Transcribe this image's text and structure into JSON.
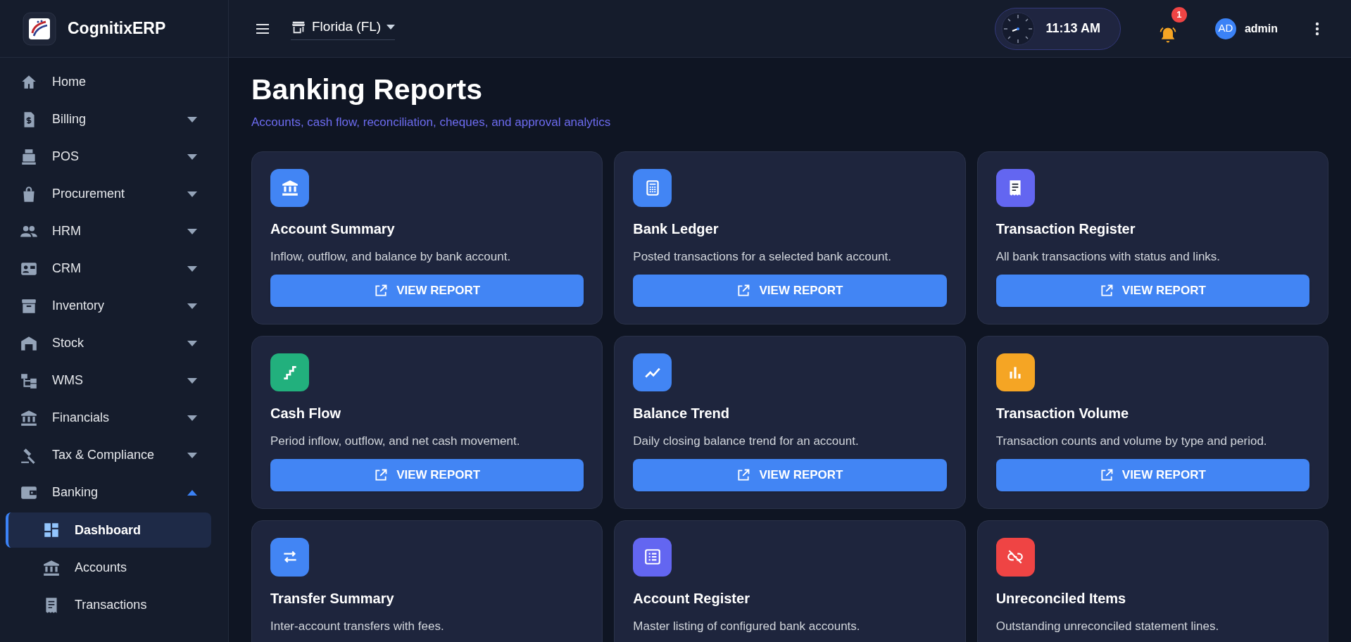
{
  "brand": {
    "name": "CognitixERP"
  },
  "sidebar": {
    "items": [
      {
        "label": "Home",
        "kind": "link"
      },
      {
        "label": "Billing",
        "kind": "group",
        "expanded": false
      },
      {
        "label": "POS",
        "kind": "group",
        "expanded": false
      },
      {
        "label": "Procurement",
        "kind": "group",
        "expanded": false
      },
      {
        "label": "HRM",
        "kind": "group",
        "expanded": false
      },
      {
        "label": "CRM",
        "kind": "group",
        "expanded": false
      },
      {
        "label": "Inventory",
        "kind": "group",
        "expanded": false
      },
      {
        "label": "Stock",
        "kind": "group",
        "expanded": false
      },
      {
        "label": "WMS",
        "kind": "group",
        "expanded": false
      },
      {
        "label": "Financials",
        "kind": "group",
        "expanded": false
      },
      {
        "label": "Tax & Compliance",
        "kind": "group",
        "expanded": false
      },
      {
        "label": "Banking",
        "kind": "group",
        "expanded": true,
        "children": [
          {
            "label": "Dashboard",
            "selected": true
          },
          {
            "label": "Accounts",
            "selected": false
          },
          {
            "label": "Transactions",
            "selected": false
          }
        ]
      }
    ]
  },
  "header": {
    "location": "Florida (FL)",
    "time": "11:13 AM",
    "notifications": "1",
    "avatar": "AD",
    "user": "admin"
  },
  "page": {
    "title": "Banking Reports",
    "subtitle": "Accounts, cash flow, reconciliation, cheques, and approval analytics"
  },
  "cards": [
    {
      "title": "Account Summary",
      "description": "Inflow, outflow, and balance by bank account.",
      "color": "#4285f4",
      "button": "VIEW REPORT"
    },
    {
      "title": "Bank Ledger",
      "description": "Posted transactions for a selected bank account.",
      "color": "#4285f4",
      "button": "VIEW REPORT"
    },
    {
      "title": "Transaction Register",
      "description": "All bank transactions with status and links.",
      "color": "#6366f1",
      "button": "VIEW REPORT"
    },
    {
      "title": "Cash Flow",
      "description": "Period inflow, outflow, and net cash movement.",
      "color": "#22b07d",
      "button": "VIEW REPORT"
    },
    {
      "title": "Balance Trend",
      "description": "Daily closing balance trend for an account.",
      "color": "#4285f4",
      "button": "VIEW REPORT"
    },
    {
      "title": "Transaction Volume",
      "description": "Transaction counts and volume by type and period.",
      "color": "#f5a524",
      "button": "VIEW REPORT"
    },
    {
      "title": "Transfer Summary",
      "description": "Inter-account transfers with fees.",
      "color": "#4285f4"
    },
    {
      "title": "Account Register",
      "description": "Master listing of configured bank accounts.",
      "color": "#6366f1"
    },
    {
      "title": "Unreconciled Items",
      "description": "Outstanding unreconciled statement lines.",
      "color": "#ef4444"
    }
  ]
}
